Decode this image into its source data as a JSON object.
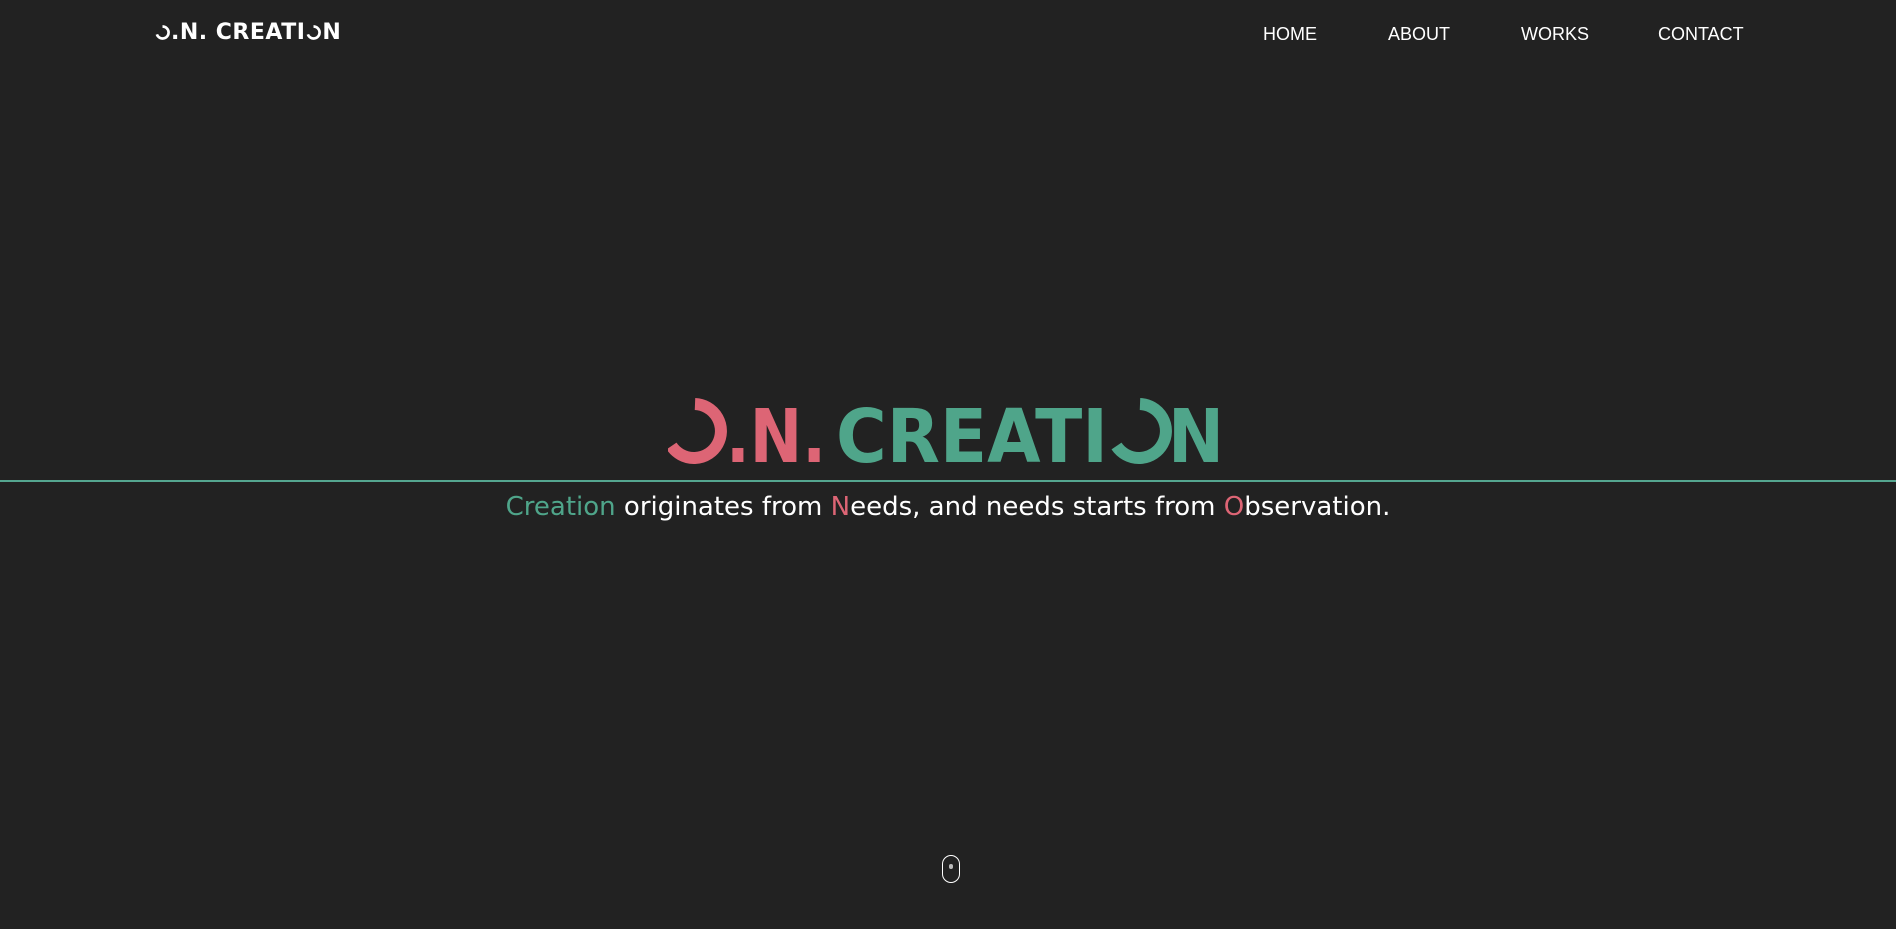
{
  "header": {
    "brand_prefix": "O",
    "brand_rest": ".N. CREATI",
    "brand_o2": "O",
    "brand_n": "N",
    "nav": [
      {
        "label": "HOME"
      },
      {
        "label": "ABOUT"
      },
      {
        "label": "WORKS"
      },
      {
        "label": "CONTACT"
      }
    ]
  },
  "hero": {
    "logo_part_pink": "O.N.",
    "logo_part_green": "CREATION",
    "tagline": {
      "w1_accent": "Creation",
      "w1_rest": " originates from ",
      "w2_accent": "N",
      "w2_rest": "eeds, and needs starts from ",
      "w3_accent": "O",
      "w3_rest": "bservation."
    }
  },
  "colors": {
    "background": "#222222",
    "accent_green": "#4fa58a",
    "accent_pink": "#dd6575",
    "text": "#ffffff"
  },
  "icons": {
    "scroll": "mouse-scroll-icon"
  }
}
